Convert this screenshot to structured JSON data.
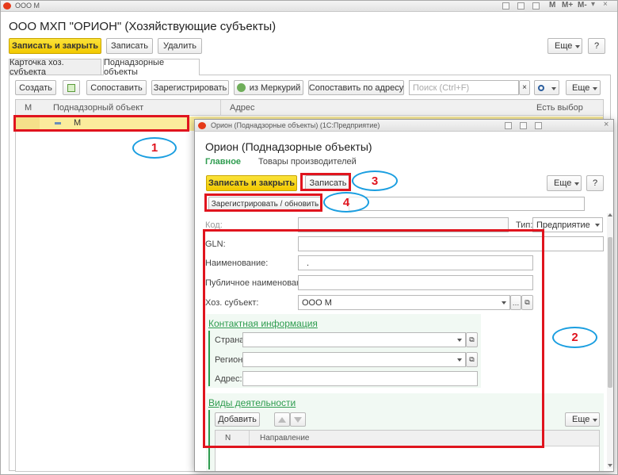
{
  "main_window": {
    "titlebar": "ООО М",
    "title": "ООО МХП \"ОРИОН\" (Хозяйствующие субъекты)",
    "tb_m": "M",
    "tb_mplus": "M+",
    "tb_mminus": "M-",
    "buttons": {
      "save_close": "Записать и закрыть",
      "save": "Записать",
      "delete": "Удалить",
      "more": "Еще",
      "help": "?"
    },
    "tabs": [
      "Карточка хоз. субъекта",
      "Поднадзорные объекты"
    ],
    "toolbar": {
      "create": "Создать",
      "match": "Сопоставить",
      "register": "Зарегистрировать",
      "from_mercury": "из Меркурий",
      "match_address": "Сопоставить по адресу",
      "search_placeholder": "Поиск (Ctrl+F)",
      "clear": "×",
      "more": "Еще"
    },
    "table": {
      "columns": [
        "М",
        "Поднадзорный объект",
        "Адрес",
        "Есть выбор"
      ],
      "rows": [
        {
          "object": "М"
        }
      ]
    }
  },
  "dialog": {
    "titlebar": "Орион (Поднадзорные объекты) (1С:Предприятие)",
    "title": "Орион (Поднадзорные объекты)",
    "tabs": [
      "Главное",
      "Товары производителей"
    ],
    "buttons": {
      "save_close": "Записать и закрыть",
      "save": "Записать",
      "register": "Зарегистрировать / обновить",
      "more": "Еще",
      "help": "?"
    },
    "fields": {
      "code_label": "Код:",
      "code_value": "",
      "type_label": "Тип:",
      "type_value": "Предприятие",
      "gln_label": "GLN:",
      "gln_value": "",
      "name_label": "Наименование:",
      "name_value": ".",
      "public_name_label": "Публичное наименование:",
      "public_name_value": "",
      "entity_label": "Хоз. субъект:",
      "entity_value": "ООО М"
    },
    "contact": {
      "heading": "Контактная информация",
      "country_label": "Страна:",
      "region_label": "Регион:",
      "address_label": "Адрес:"
    },
    "activities": {
      "heading": "Виды деятельности",
      "add": "Добавить",
      "more": "Еще",
      "columns": [
        "N",
        "Направление"
      ]
    }
  },
  "annotations": [
    "1",
    "2",
    "3",
    "4"
  ],
  "colors": {
    "accent_yellow": "#f2c900",
    "annotation_red": "#e0141e",
    "annotation_blue": "#1a9ee0",
    "link_green": "#2e9c4f",
    "row_highlight": "#fbec9c"
  }
}
